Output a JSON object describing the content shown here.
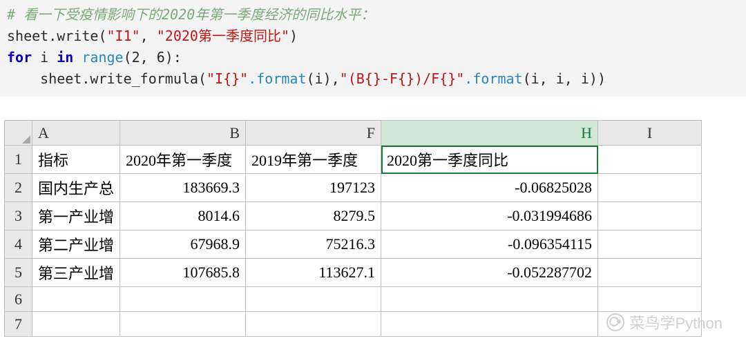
{
  "code": {
    "comment": "# 看一下受疫情影响下的2020年第一季度经济的同比水平：",
    "line2_pre": "sheet.write(",
    "line2_str1": "\"I1\"",
    "line2_comma": ", ",
    "line2_str2": "\"2020第一季度同比\"",
    "line2_post": ")",
    "line3_for": "for",
    "line3_i": " i ",
    "line3_in": "in",
    "line3_range": " range",
    "line3_args": "(2, 6):",
    "line4_indent": "    sheet.write_formula(",
    "line4_str1": "\"I{}\"",
    "line4_dotfmt1": ".format",
    "line4_args1": "(i),",
    "line4_str2": "\"(B{}-F{})/F{}\"",
    "line4_dotfmt2": ".format",
    "line4_args2": "(i, i, i))"
  },
  "sheet": {
    "col_headers": {
      "A": "A",
      "B": "B",
      "F": "F",
      "H": "H",
      "I": "I"
    },
    "row_headers": [
      "1",
      "2",
      "3",
      "4",
      "5",
      "6",
      "7"
    ],
    "rows": [
      {
        "A": "指标",
        "B": "2020年第一季度",
        "F": "2019年第一季度",
        "H": "2020第一季度同比",
        "I": ""
      },
      {
        "A": "国内生产总",
        "B": "183669.3",
        "F": "197123",
        "H": "-0.06825028",
        "I": ""
      },
      {
        "A": "第一产业增",
        "B": "8014.6",
        "F": "8279.5",
        "H": "-0.031994686",
        "I": ""
      },
      {
        "A": "第二产业增",
        "B": "67968.9",
        "F": "75216.3",
        "H": "-0.096354115",
        "I": ""
      },
      {
        "A": "第三产业增",
        "B": "107685.8",
        "F": "113627.1",
        "H": "-0.052287702",
        "I": ""
      },
      {
        "A": "",
        "B": "",
        "F": "",
        "H": "",
        "I": ""
      },
      {
        "A": "",
        "B": "",
        "F": "",
        "H": "",
        "I": ""
      }
    ]
  },
  "watermark": {
    "text": "菜鸟学Python"
  },
  "chart_data": {
    "type": "table",
    "title": "2020第一季度同比",
    "columns": [
      "指标",
      "2020年第一季度",
      "2019年第一季度",
      "2020第一季度同比"
    ],
    "rows": [
      [
        "国内生产总值",
        183669.3,
        197123,
        -0.06825028
      ],
      [
        "第一产业增加值",
        8014.6,
        8279.5,
        -0.031994686
      ],
      [
        "第二产业增加值",
        67968.9,
        75216.3,
        -0.096354115
      ],
      [
        "第三产业增加值",
        107685.8,
        113627.1,
        -0.052287702
      ]
    ]
  }
}
